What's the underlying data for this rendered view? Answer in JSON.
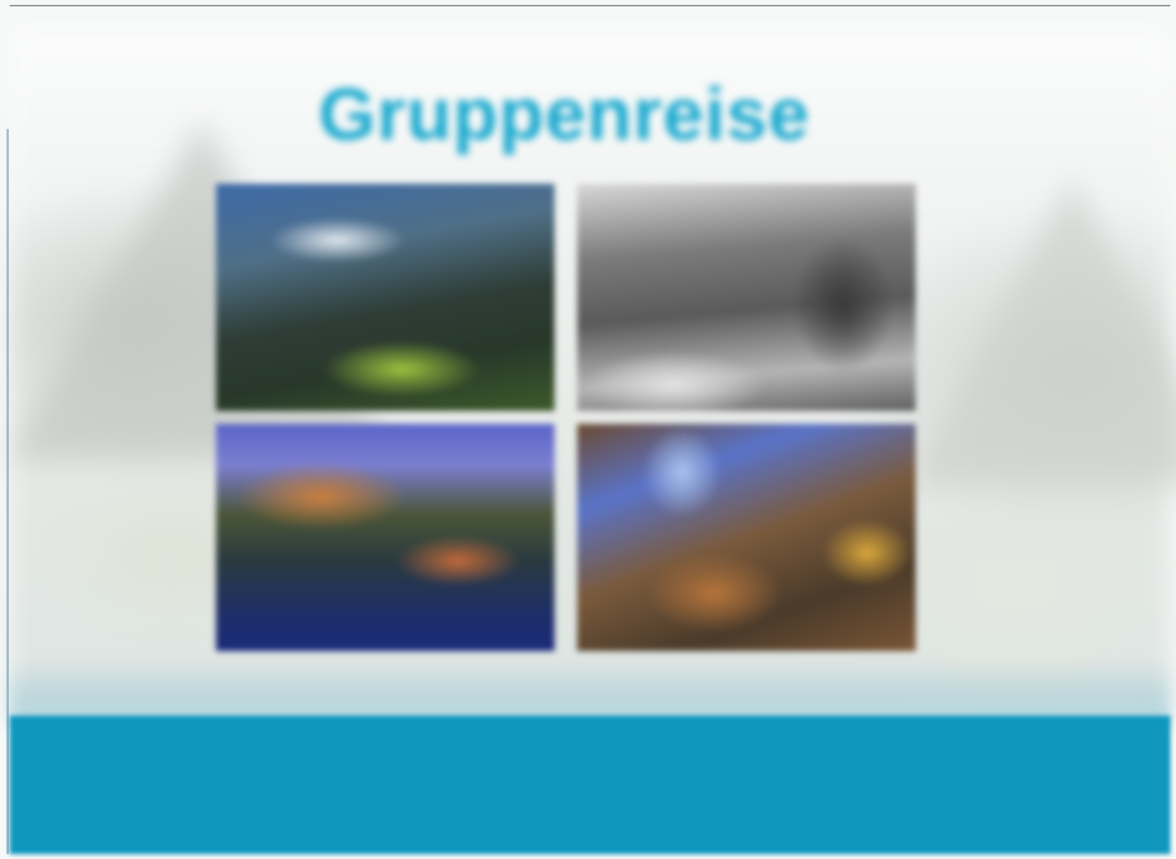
{
  "slide": {
    "title": "Gruppenreise",
    "side_labels": {
      "left_upper": "",
      "right_upper": "",
      "left_lower": "",
      "right_lower": ""
    },
    "photos": [
      {
        "icon": "mountain-valley-photo",
        "alt": ""
      },
      {
        "icon": "glacier-photo",
        "alt": ""
      },
      {
        "icon": "lake-boat-photo",
        "alt": ""
      },
      {
        "icon": "rock-arch-photo",
        "alt": ""
      }
    ],
    "footer": {
      "lead": {
        "name": "",
        "sub": ""
      },
      "items": [
        {
          "name": "",
          "sub": ""
        },
        {
          "name": "",
          "sub": ""
        },
        {
          "name": "",
          "sub": ""
        },
        {
          "name": "",
          "sub": ""
        }
      ]
    },
    "colors": {
      "accent": "#1aa9cf",
      "footer": "#0f97bf"
    }
  }
}
